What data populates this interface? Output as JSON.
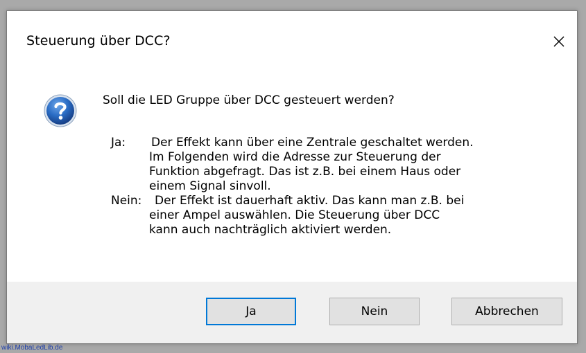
{
  "dialog": {
    "title": "Steuerung über DCC?",
    "close_symbol": "✕",
    "icon": "question-icon",
    "question": "Soll die LED Gruppe über DCC gesteuert werden?",
    "answers": {
      "ja_label": "Ja:",
      "ja_lines": [
        "Der Effekt kann über eine Zentrale geschaltet werden.",
        "Im Folgenden wird die Adresse zur Steuerung der",
        "Funktion abgefragt. Das ist z.B. bei einem Haus oder",
        "einem Signal sinvoll."
      ],
      "nein_label": "Nein:",
      "nein_lines": [
        "Der Effekt ist dauerhaft aktiv. Das kann man z.B. bei",
        "einer Ampel auswählen. Die Steuerung über DCC",
        "kann auch nachträglich aktiviert werden."
      ]
    },
    "buttons": {
      "ja": "Ja",
      "nein": "Nein",
      "abbrechen": "Abbrechen"
    },
    "accent_color": "#0078d7"
  },
  "watermark": "wiki.MobaLedLib.de"
}
